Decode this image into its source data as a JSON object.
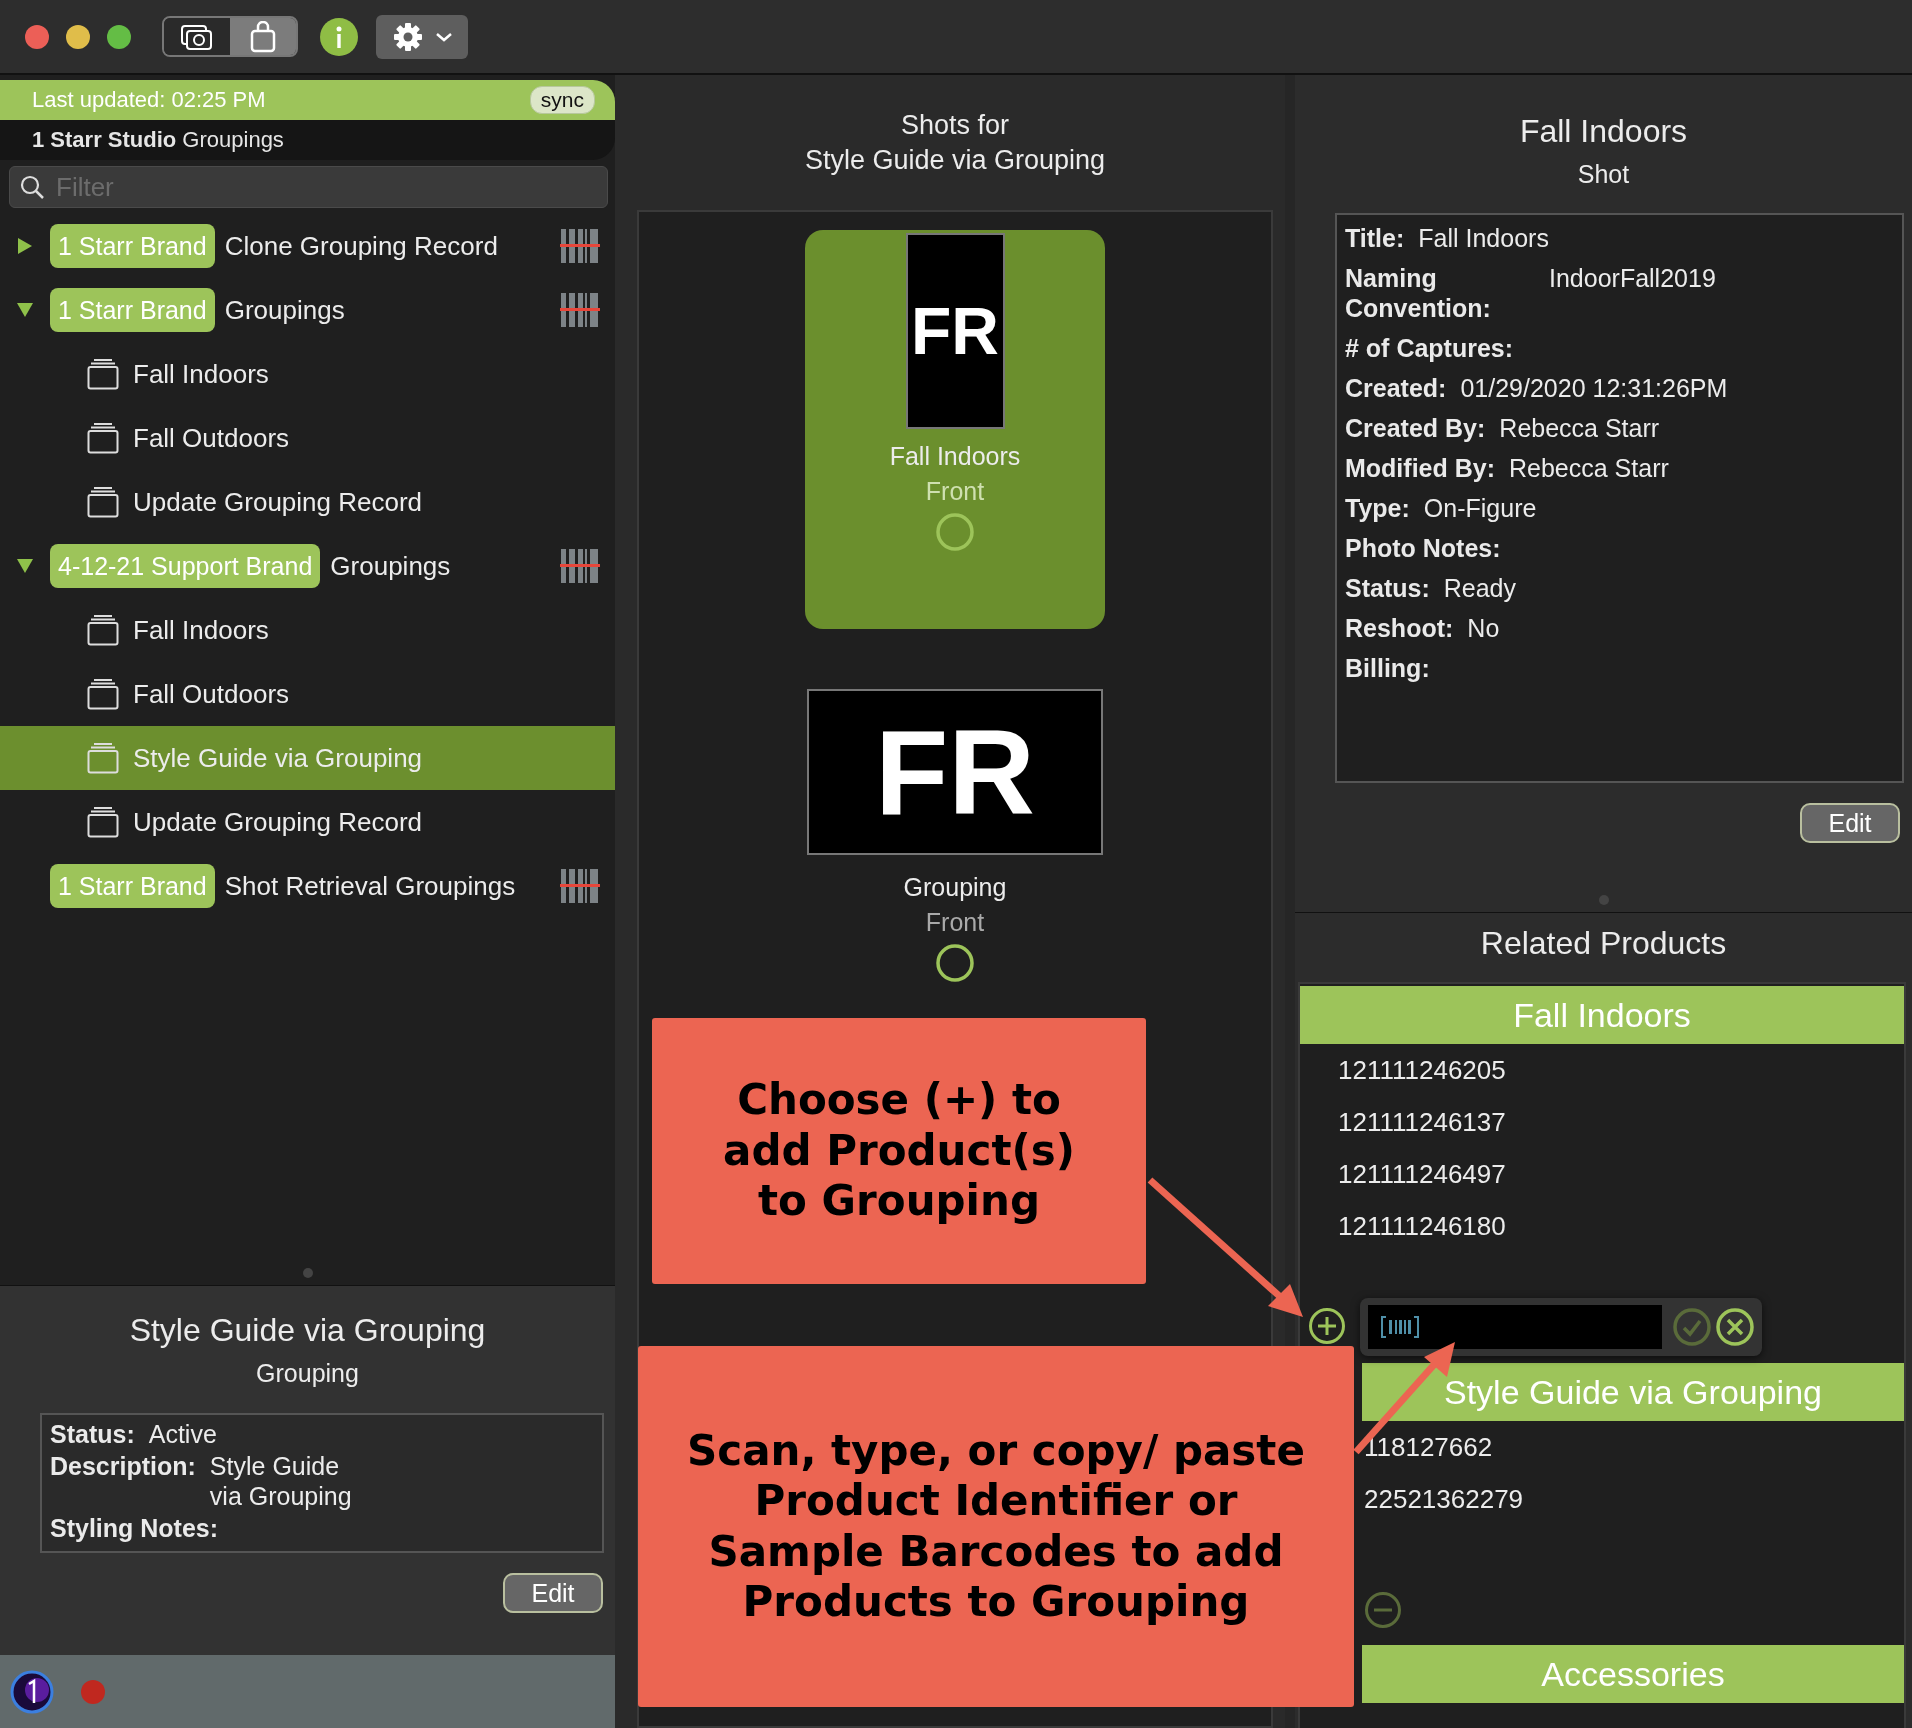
{
  "toolbar": {
    "segments": [
      {
        "selected": false
      },
      {
        "selected": true
      }
    ]
  },
  "sidebar": {
    "last_updated": "Last updated: 02:25 PM",
    "sync_button": "sync",
    "studio_name": "1 Starr Studio",
    "studio_suffix": "Groupings",
    "filter_placeholder": "Filter",
    "tree": [
      {
        "kind": "brand",
        "tag": "1 Starr Brand",
        "label": "Clone Grouping Record",
        "expanded": false,
        "selected": false
      },
      {
        "kind": "brand",
        "tag": "1 Starr Brand",
        "label": "Groupings",
        "expanded": true,
        "selected": false,
        "children": [
          {
            "kind": "grouping",
            "label": "Fall Indoors",
            "selected": false
          },
          {
            "kind": "grouping",
            "label": "Fall Outdoors",
            "selected": false
          },
          {
            "kind": "grouping",
            "label": "Update Grouping Record",
            "selected": false
          }
        ]
      },
      {
        "kind": "brand",
        "tag": "4-12-21 Support Brand",
        "label": "Groupings",
        "expanded": true,
        "selected": false,
        "children": [
          {
            "kind": "grouping",
            "label": "Fall Indoors",
            "selected": false
          },
          {
            "kind": "grouping",
            "label": "Fall Outdoors",
            "selected": false
          },
          {
            "kind": "grouping",
            "label": "Style Guide via Grouping",
            "selected": true
          },
          {
            "kind": "grouping",
            "label": "Update Grouping Record",
            "selected": false
          }
        ]
      },
      {
        "kind": "brand",
        "tag": "1 Starr Brand",
        "label": "Shot Retrieval Groupings",
        "selected": false
      }
    ],
    "detail": {
      "title": "Style Guide via Grouping",
      "subtitle": "Grouping",
      "fields": [
        {
          "label": "Status:",
          "value": "Active"
        },
        {
          "label": "Description:",
          "value": "Style Guide via Grouping"
        },
        {
          "label": "Styling Notes:"
        }
      ],
      "edit_button": "Edit"
    }
  },
  "shots": {
    "title_lines": [
      "Shots for",
      "Style Guide via Grouping"
    ],
    "items": [
      {
        "kind": "portrait",
        "thumbnail_text": "FR",
        "name": "Fall Indoors",
        "view": "Front",
        "selected": true
      },
      {
        "kind": "landscape",
        "thumbnail_text": "FR",
        "name": "Grouping",
        "view": "Front",
        "selected": false
      }
    ]
  },
  "shot_detail": {
    "title": "Fall Indoors",
    "subtitle": "Shot",
    "fields": [
      {
        "label": "Title:",
        "value": "Fall Indoors"
      },
      {
        "label": "Naming Convention:",
        "value": "IndoorFall2019"
      },
      {
        "label": "# of Captures:"
      },
      {
        "label": "Created:",
        "value": "01/29/2020 12:31:26PM"
      },
      {
        "label": "Created By:",
        "value": "Rebecca Starr"
      },
      {
        "label": "Modified By:",
        "value": "Rebecca Starr"
      },
      {
        "label": "Type:",
        "value": "On-Figure"
      },
      {
        "label": "Photo Notes:"
      },
      {
        "label": "Status:",
        "value": "Ready"
      },
      {
        "label": "Reshoot:",
        "value": "No"
      },
      {
        "label": "Billing:"
      }
    ],
    "edit_button": "Edit"
  },
  "related_products": {
    "title": "Related Products",
    "groups": [
      {
        "name": "Fall Indoors",
        "items": [
          "121111246205",
          "121111246137",
          "121111246497",
          "121111246180"
        ]
      },
      {
        "name": "Style Guide via Grouping",
        "items": [
          "118127662",
          "22521362279"
        ]
      },
      {
        "name": "Accessories"
      }
    ]
  },
  "callouts": [
    {
      "text": "Choose (+) to add Product(s) to Grouping"
    },
    {
      "text": "Scan, type, or copy/ paste Product Identifier or Sample Barcodes to add Products to Grouping"
    }
  ]
}
